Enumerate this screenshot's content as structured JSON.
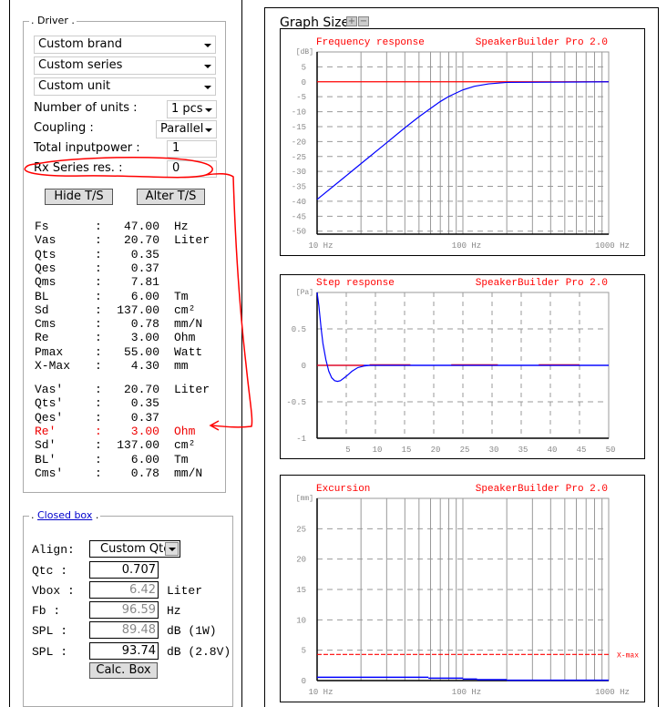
{
  "driver": {
    "legend": "Driver",
    "brand": "Custom brand",
    "series": "Custom series",
    "unit": "Custom unit",
    "units_label": "Number of units :",
    "units_value": "1 pcs",
    "coupling_label": "Coupling :",
    "coupling_value": "Parallel",
    "power_label": "Total inputpower :",
    "power_value": "1",
    "rx_label": "Rx Series res. :",
    "rx_value": "0",
    "hide_ts": "Hide T/S",
    "alter_ts": "Alter T/S",
    "params": [
      {
        "n": "Fs",
        "v": "47.00",
        "u": "Hz"
      },
      {
        "n": "Vas",
        "v": "20.70",
        "u": "Liter"
      },
      {
        "n": "Qts",
        "v": "0.35",
        "u": ""
      },
      {
        "n": "Qes",
        "v": "0.37",
        "u": ""
      },
      {
        "n": "Qms",
        "v": "7.81",
        "u": ""
      },
      {
        "n": "BL",
        "v": "6.00",
        "u": "Tm"
      },
      {
        "n": "Sd",
        "v": "137.00",
        "u": "cm²"
      },
      {
        "n": "Cms",
        "v": "0.78",
        "u": "mm/N"
      },
      {
        "n": "Re",
        "v": "3.00",
        "u": "Ohm"
      },
      {
        "n": "Pmax",
        "v": "55.00",
        "u": "Watt"
      },
      {
        "n": "X-Max",
        "v": "4.30",
        "u": "mm"
      }
    ],
    "derived": [
      {
        "n": "Vas'",
        "v": "20.70",
        "u": "Liter"
      },
      {
        "n": "Qts'",
        "v": "0.35",
        "u": ""
      },
      {
        "n": "Qes'",
        "v": "0.37",
        "u": ""
      },
      {
        "n": "Re'",
        "v": "3.00",
        "u": "Ohm",
        "highlight": true
      },
      {
        "n": "Sd'",
        "v": "137.00",
        "u": "cm²"
      },
      {
        "n": "BL'",
        "v": "6.00",
        "u": "Tm"
      },
      {
        "n": "Cms'",
        "v": "0.78",
        "u": "mm/N"
      }
    ],
    "colon": ":"
  },
  "box": {
    "legend": "Closed box",
    "align_label": "Align:",
    "align_value": "Custom Qtc",
    "qtc_label": "Qtc  :",
    "qtc": "0.707",
    "vbox_label": "Vbox :",
    "vbox": "6.42",
    "vbox_unit": "Liter",
    "fb_label": "Fb   :",
    "fb": "96.59",
    "fb_unit": "Hz",
    "spl1_label": "SPL  :",
    "spl1": "89.48",
    "spl1_unit": "dB (1W)",
    "spl2_label": "SPL  :",
    "spl2": "93.74",
    "spl2_unit": "dB (2.8V)",
    "calc": "Calc. Box"
  },
  "graph_size": {
    "label": "Graph Size",
    "plus": "+",
    "minus": "−"
  },
  "colors": {
    "curve": "#0000ff",
    "reference": "#ff0000",
    "grid": "#999999",
    "title": "#ff0000",
    "annotation": "#ff0000"
  },
  "chart_data": [
    {
      "type": "line",
      "title": "Frequency response",
      "brand": "SpeakerBuilder Pro 2.0",
      "ylabel": "[dB]",
      "xscale": "log",
      "xlim": [
        10,
        1000
      ],
      "ylim": [
        -51,
        10
      ],
      "yticks": [
        5,
        0,
        -5,
        -10,
        -15,
        -20,
        -25,
        -30,
        -35,
        -40,
        -45,
        -50
      ],
      "xtick_labels": [
        {
          "x": 10,
          "t": "10 Hz"
        },
        {
          "x": 100,
          "t": "100 Hz"
        },
        {
          "x": 1000,
          "t": "1000 Hz"
        }
      ],
      "reference": 0,
      "points": [
        [
          10,
          -39.4
        ],
        [
          15,
          -32.4
        ],
        [
          20,
          -27.4
        ],
        [
          30,
          -20.4
        ],
        [
          40,
          -15.4
        ],
        [
          50,
          -11.7
        ],
        [
          60,
          -8.9
        ],
        [
          70,
          -6.6
        ],
        [
          80,
          -4.9
        ],
        [
          100,
          -2.7
        ],
        [
          120,
          -1.5
        ],
        [
          150,
          -0.7
        ],
        [
          200,
          -0.2
        ],
        [
          1000,
          0
        ]
      ]
    },
    {
      "type": "line",
      "title": "Step response",
      "brand": "SpeakerBuilder Pro 2.0",
      "ylabel": "[Pa]",
      "xlim": [
        0,
        50
      ],
      "ylim": [
        -1,
        1
      ],
      "yticks": [
        0.5,
        0,
        -0.5,
        -1
      ],
      "xticks": [
        5,
        10,
        15,
        20,
        25,
        30,
        35,
        40,
        45,
        50
      ],
      "reference_segments": [
        [
          0,
          16
        ],
        [
          23,
          31
        ],
        [
          38,
          45
        ]
      ],
      "points": [
        [
          0,
          1
        ],
        [
          0.3,
          0.82
        ],
        [
          0.7,
          0.5
        ],
        [
          1,
          0.3
        ],
        [
          1.5,
          0.08
        ],
        [
          2,
          -0.08
        ],
        [
          2.5,
          -0.17
        ],
        [
          3,
          -0.21
        ],
        [
          3.5,
          -0.22
        ],
        [
          4,
          -0.21
        ],
        [
          5,
          -0.15
        ],
        [
          6,
          -0.08
        ],
        [
          7,
          -0.03
        ],
        [
          8,
          -0.01
        ],
        [
          9,
          0
        ],
        [
          50,
          0
        ]
      ]
    },
    {
      "type": "line",
      "title": "Excursion",
      "brand": "SpeakerBuilder Pro 2.0",
      "ylabel": "[mm]",
      "xscale": "log",
      "xlim": [
        10,
        1000
      ],
      "ylim": [
        0,
        30
      ],
      "yticks": [
        25,
        20,
        15,
        10,
        5,
        0
      ],
      "xtick_labels": [
        {
          "x": 10,
          "t": "10 Hz"
        },
        {
          "x": 100,
          "t": "100 Hz"
        },
        {
          "x": 1000,
          "t": "1000 Hz"
        }
      ],
      "xmax": 4.3,
      "xmax_label": "X-max",
      "steps": [
        [
          10,
          58,
          0.55
        ],
        [
          58,
          100,
          0.4
        ],
        [
          100,
          125,
          0.25
        ],
        [
          125,
          200,
          0.15
        ],
        [
          200,
          1000,
          0.05
        ]
      ]
    }
  ]
}
